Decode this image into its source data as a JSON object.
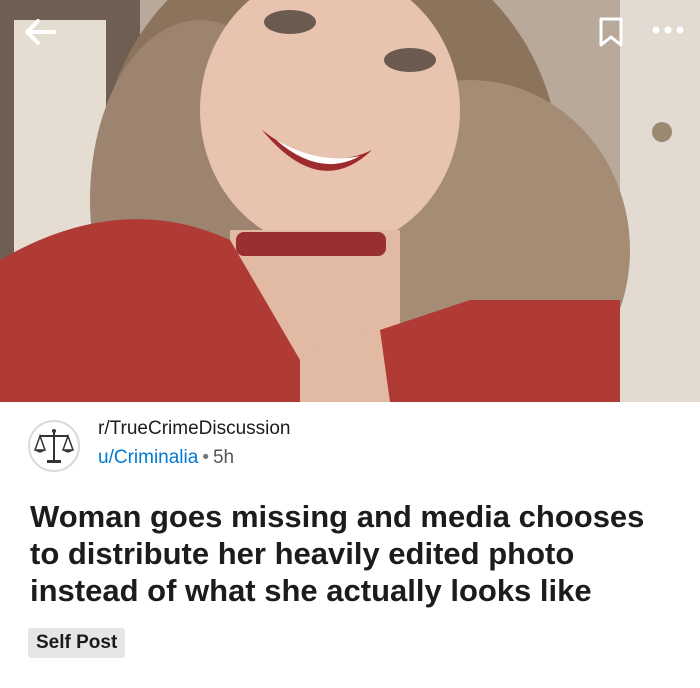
{
  "post": {
    "subreddit": "r/TrueCrimeDiscussion",
    "author": "u/Criminalia",
    "separator": "•",
    "age": "5h",
    "title": "Woman goes missing and media chooses to distribute her heavily edited photo instead of what she actually looks like",
    "flair": "Self Post"
  },
  "icons": {
    "back": "arrow-left-icon",
    "bookmark": "bookmark-icon",
    "more": "more-horizontal-icon",
    "avatar": "scales-of-justice-icon"
  },
  "colors": {
    "username": "#0079d3",
    "flair_bg": "#e6e6e6",
    "text": "#1c1c1c"
  }
}
